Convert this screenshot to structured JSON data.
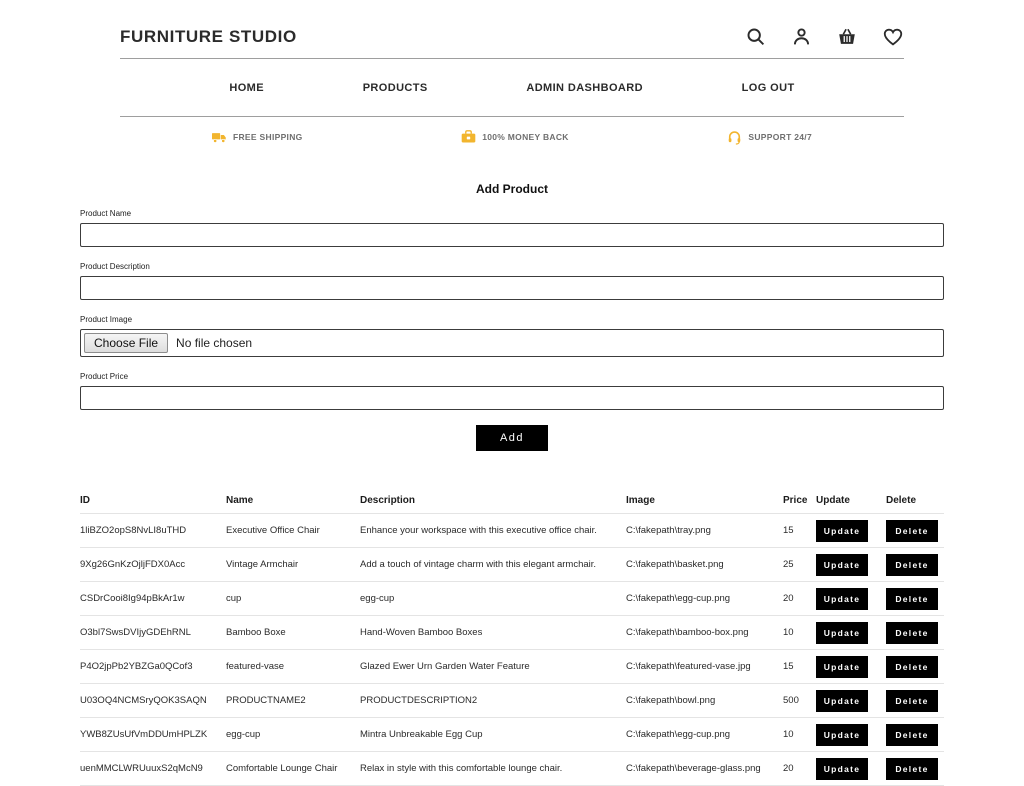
{
  "header": {
    "logo": "FURNITURE STUDIO",
    "icons": [
      "search",
      "account",
      "basket",
      "wishlist"
    ]
  },
  "nav": {
    "items": [
      "HOME",
      "PRODUCTS",
      "ADMIN DASHBOARD",
      "LOG OUT"
    ]
  },
  "features": [
    {
      "icon": "truck-icon",
      "label": "FREE SHIPPING"
    },
    {
      "icon": "money-back-icon",
      "label": "100% MONEY BACK"
    },
    {
      "icon": "headset-icon",
      "label": "SUPPORT 24/7"
    }
  ],
  "form": {
    "title": "Add Product",
    "name_label": "Product Name",
    "description_label": "Product Description",
    "image_label": "Product Image",
    "price_label": "Product Price",
    "name_value": "",
    "description_value": "",
    "price_value": "",
    "choose_file_label": "Choose File",
    "file_status": "No file chosen",
    "submit_label": "Add"
  },
  "table": {
    "headers": [
      "ID",
      "Name",
      "Description",
      "Image",
      "Price",
      "Update",
      "Delete"
    ],
    "update_label": "Update",
    "delete_label": "Delete",
    "rows": [
      {
        "id": "1liBZO2opS8NvLI8uTHD",
        "name": "Executive Office Chair",
        "description": "Enhance your workspace with this executive office chair.",
        "image": "C:\\fakepath\\tray.png",
        "price": "15"
      },
      {
        "id": "9Xg26GnKzOjljFDX0Acc",
        "name": "Vintage Armchair",
        "description": "Add a touch of vintage charm with this elegant armchair.",
        "image": "C:\\fakepath\\basket.png",
        "price": "25"
      },
      {
        "id": "CSDrCooi8Ig94pBkAr1w",
        "name": "cup",
        "description": "egg-cup",
        "image": "C:\\fakepath\\egg-cup.png",
        "price": "20"
      },
      {
        "id": "O3bl7SwsDVIjyGDEhRNL",
        "name": "Bamboo Boxe",
        "description": "Hand-Woven Bamboo Boxes",
        "image": "C:\\fakepath\\bamboo-box.png",
        "price": "10"
      },
      {
        "id": "P4O2jpPb2YBZGa0QCof3",
        "name": "featured-vase",
        "description": "Glazed Ewer Urn Garden Water Feature",
        "image": "C:\\fakepath\\featured-vase.jpg",
        "price": "15"
      },
      {
        "id": "U03OQ4NCMSryQOK3SAQN",
        "name": "PRODUCTNAME2",
        "description": "PRODUCTDESCRIPTION2",
        "image": "C:\\fakepath\\bowl.png",
        "price": "500"
      },
      {
        "id": "YWB8ZUsUfVmDDUmHPLZK",
        "name": "egg-cup",
        "description": "Mintra Unbreakable Egg Cup",
        "image": "C:\\fakepath\\egg-cup.png",
        "price": "10"
      },
      {
        "id": "uenMMCLWRUuuxS2qMcN9",
        "name": "Comfortable Lounge Chair",
        "description": "Relax in style with this comfortable lounge chair.",
        "image": "C:\\fakepath\\beverage-glass.png",
        "price": "20"
      }
    ]
  },
  "colors": {
    "accent_gold": "#F2B52E",
    "button_bg": "#000000",
    "text": "#212121",
    "muted": "#6F6F6F",
    "divider": "#9E9E9E",
    "row_border": "#E4E4E4"
  }
}
